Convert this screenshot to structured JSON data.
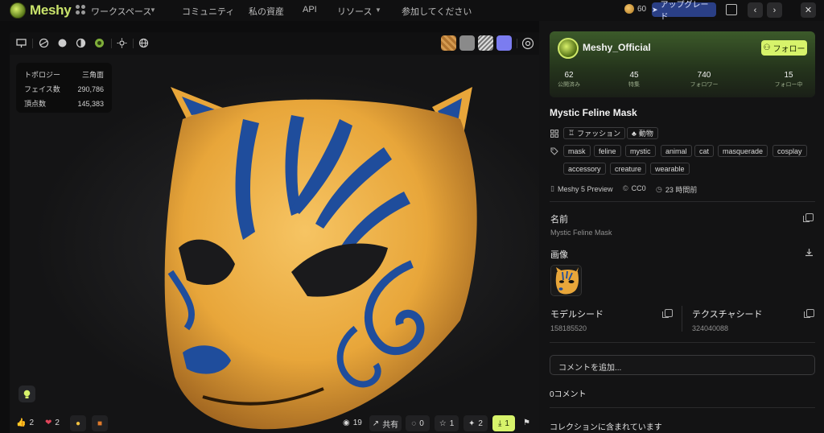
{
  "brand": {
    "name": "Meshy"
  },
  "nav": {
    "workspace": "ワークスペース",
    "community": "コミュニティ",
    "assets": "私の資産",
    "api": "API",
    "resources": "リソース",
    "join": "参加してください"
  },
  "account": {
    "credits": "60",
    "upgrade_label": "アップグレード"
  },
  "viewer": {
    "stats": {
      "topology_label": "トポロジー",
      "topology_value": "三角面",
      "faces_label": "フェイス数",
      "faces_value": "290,786",
      "vertices_label": "頂点数",
      "vertices_value": "145,383"
    },
    "reactions": {
      "like": "2",
      "heart": "2"
    },
    "footer": {
      "views": "19",
      "share_label": "共有",
      "comments": "0",
      "stars": "1",
      "remix": "2",
      "downloads": "1"
    },
    "swatch_colors": [
      "#c58a3a",
      "#8a8a8a",
      "#d8d8d8",
      "#7b7cf0"
    ]
  },
  "author": {
    "name": "Meshy_Official",
    "follow_label": "フォロー",
    "stats": [
      {
        "value": "62",
        "label": "公開済み"
      },
      {
        "value": "45",
        "label": "特集"
      },
      {
        "value": "740",
        "label": "フォロワー"
      },
      {
        "value": "15",
        "label": "フォロー中"
      }
    ]
  },
  "model": {
    "title": "Mystic Feline Mask",
    "categories": [
      "ファッション",
      "動物"
    ],
    "tags_row1": [
      "mask",
      "feline",
      "mystic",
      "animal",
      "cat",
      "masquerade",
      "cosplay"
    ],
    "tags_row2": [
      "accessory",
      "creature",
      "wearable"
    ],
    "engine": "Meshy 5 Preview",
    "license": "CC0",
    "time": "23 時間前",
    "name_label": "名前",
    "name_value": "Mystic Feline Mask",
    "image_label": "画像",
    "model_seed_label": "モデルシード",
    "model_seed_value": "158185520",
    "texture_seed_label": "テクスチャシード",
    "texture_seed_value": "324040088"
  },
  "comments": {
    "placeholder": "コメントを追加...",
    "count_label": "0コメント",
    "collection_label": "コレクションに含まれています"
  },
  "colors": {
    "accent": "#d7f36b",
    "upgrade": "#2a3f86",
    "mask_orange": "#e8a63a",
    "mask_blue": "#1f4d9c"
  }
}
